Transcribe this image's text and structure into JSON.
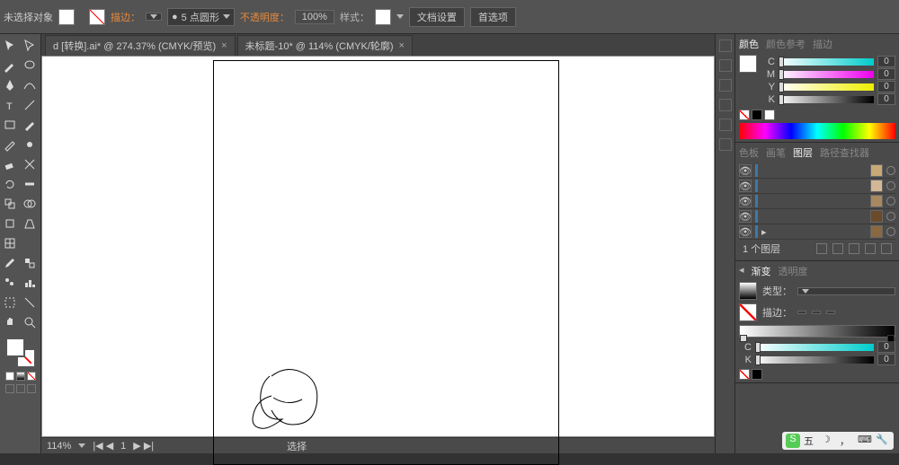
{
  "topbar": {
    "selection": "未选择对象",
    "stroke": "描边：",
    "stroke_style": "5 点圆形",
    "opacity": "不透明度：",
    "opacity_val": "100%",
    "style": "样式：",
    "doc_setup": "文档设置",
    "prefs": "首选项"
  },
  "tabs": [
    {
      "label": "d [转换].ai* @ 274.37% (CMYK/预览)"
    },
    {
      "label": "未标题-10* @ 114% (CMYK/轮廓)"
    }
  ],
  "status": {
    "zoom": "114%",
    "page": "1",
    "mode": "选择"
  },
  "color": {
    "tab1": "颜色",
    "tab2": "颜色参考",
    "tab3": "描边",
    "c": "C",
    "m": "M",
    "y": "Y",
    "k": "K",
    "val": "0"
  },
  "layers": {
    "tab1": "色板",
    "tab2": "画笔",
    "tab3": "图层",
    "tab4": "路径查找器",
    "count": "1 个图层"
  },
  "gradient": {
    "tab1": "渐变",
    "tab2": "透明度",
    "type": "类型：",
    "stroke": "描边："
  },
  "ime": "五"
}
